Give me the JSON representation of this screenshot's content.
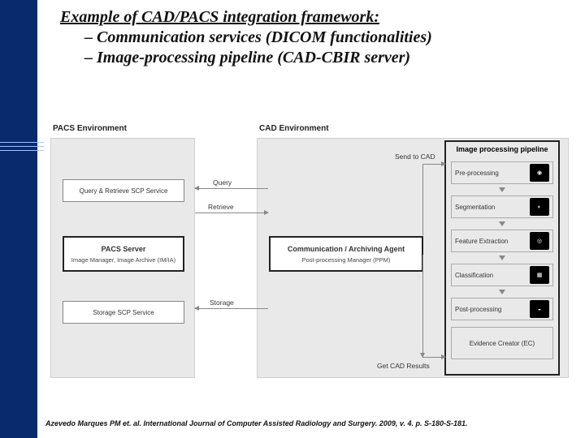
{
  "header": {
    "title": "Example of CAD/PACS integration framework:",
    "bullet1": "– Communication services (DICOM functionalities)",
    "bullet2": "– Image-processing pipeline (CAD-CBIR server)"
  },
  "pacs": {
    "title": "PACS Environment",
    "query_retrieve": "Query & Retrieve SCP Service",
    "server_label": "PACS Server",
    "server_sub": "Image Manager, Image Archive (IM/IA)",
    "storage": "Storage SCP Service"
  },
  "cad": {
    "title": "CAD Environment",
    "agent_label": "Communication / Archiving Agent",
    "agent_sub": "Post-processing Manager (PPM)",
    "pipeline_title": "Image processing pipeline",
    "stages": [
      "Pre-processing",
      "Segmentation",
      "Feature Extraction",
      "Classification",
      "Post-processing"
    ],
    "evidence": "Evidence Creator (EC)"
  },
  "arrows": {
    "query": "Query",
    "retrieve": "Retrieve",
    "storage": "Storage",
    "send": "Send to CAD",
    "results": "Get CAD Results"
  },
  "citation": "Azevedo Marques PM et. al. International Journal of Computer Assisted Radiology and Surgery. 2009, v. 4. p. S-180-S-181."
}
